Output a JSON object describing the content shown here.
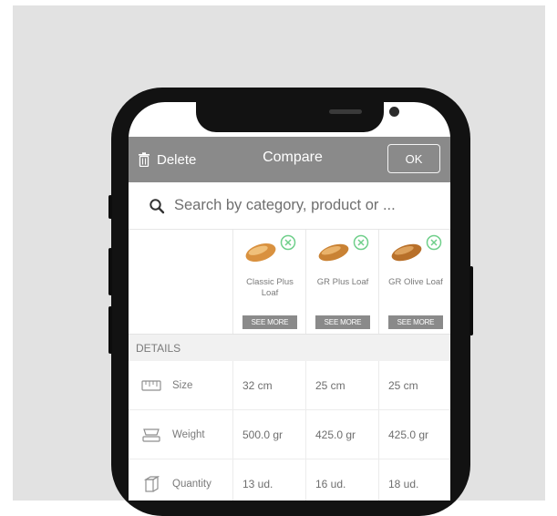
{
  "header": {
    "delete_label": "Delete",
    "title": "Compare",
    "ok_label": "OK"
  },
  "search": {
    "placeholder": "Search by category, product or ..."
  },
  "products": [
    {
      "name": "Classic Plus Loaf",
      "see_more": "SEE MORE"
    },
    {
      "name": "GR Plus Loaf",
      "see_more": "SEE MORE"
    },
    {
      "name": "GR Olive Loaf",
      "see_more": "SEE MORE"
    }
  ],
  "details": {
    "section_label": "DETAILS",
    "rows": [
      {
        "label": "Size",
        "icon": "ruler-icon",
        "values": [
          "32 cm",
          "25 cm",
          "25 cm"
        ]
      },
      {
        "label": "Weight",
        "icon": "scale-icon",
        "values": [
          "500.0 gr",
          "425.0 gr",
          "425.0 gr"
        ]
      },
      {
        "label": "Quantity",
        "icon": "box-icon",
        "values": [
          "13 ud.",
          "16 ud.",
          "18 ud."
        ]
      }
    ]
  },
  "colors": {
    "header_bar": "#8a8a8a",
    "remove_icon": "#6fcf8a",
    "bread": "#d9913f"
  }
}
